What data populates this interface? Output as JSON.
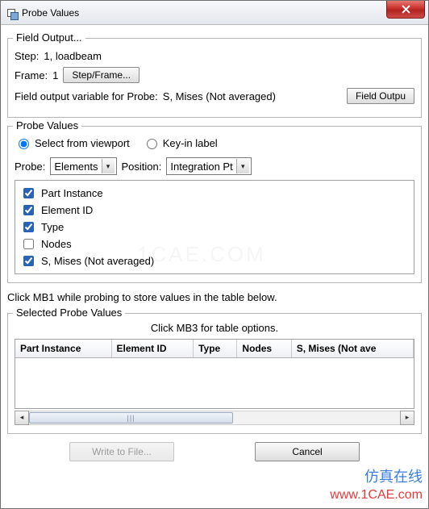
{
  "window": {
    "title": "Probe Values"
  },
  "field_output": {
    "group_label": "Field Output...",
    "step_label": "Step:",
    "step_value": "1, loadbeam",
    "frame_label": "Frame:",
    "frame_value": "1",
    "step_frame_button": "Step/Frame...",
    "var_label": "Field output variable for Probe:",
    "var_value": "S, Mises (Not averaged)",
    "field_output_button": "Field Outpu"
  },
  "probe_values": {
    "group_label": "Probe Values",
    "radio_viewport": "Select from viewport",
    "radio_keyin": "Key-in label",
    "radio_selected": "viewport",
    "probe_label": "Probe:",
    "probe_value": "Elements",
    "position_label": "Position:",
    "position_value": "Integration Pt",
    "check_items": [
      {
        "label": "Part Instance",
        "checked": true
      },
      {
        "label": "Element ID",
        "checked": true
      },
      {
        "label": "Type",
        "checked": true
      },
      {
        "label": "Nodes",
        "checked": false
      },
      {
        "label": "S, Mises (Not averaged)",
        "checked": true
      }
    ],
    "hint": "Click MB1 while probing to store values in the table below."
  },
  "selected_values": {
    "group_label": "Selected Probe Values",
    "hint": "Click MB3 for table options.",
    "columns": [
      "Part Instance",
      "Element ID",
      "Type",
      "Nodes",
      "S, Mises (Not ave"
    ]
  },
  "footer": {
    "write_button": "Write to File...",
    "cancel_button": "Cancel"
  },
  "watermarks": {
    "cn": "仿真在线",
    "url": "www.1CAE.com",
    "faint": "1CAE.COM"
  }
}
